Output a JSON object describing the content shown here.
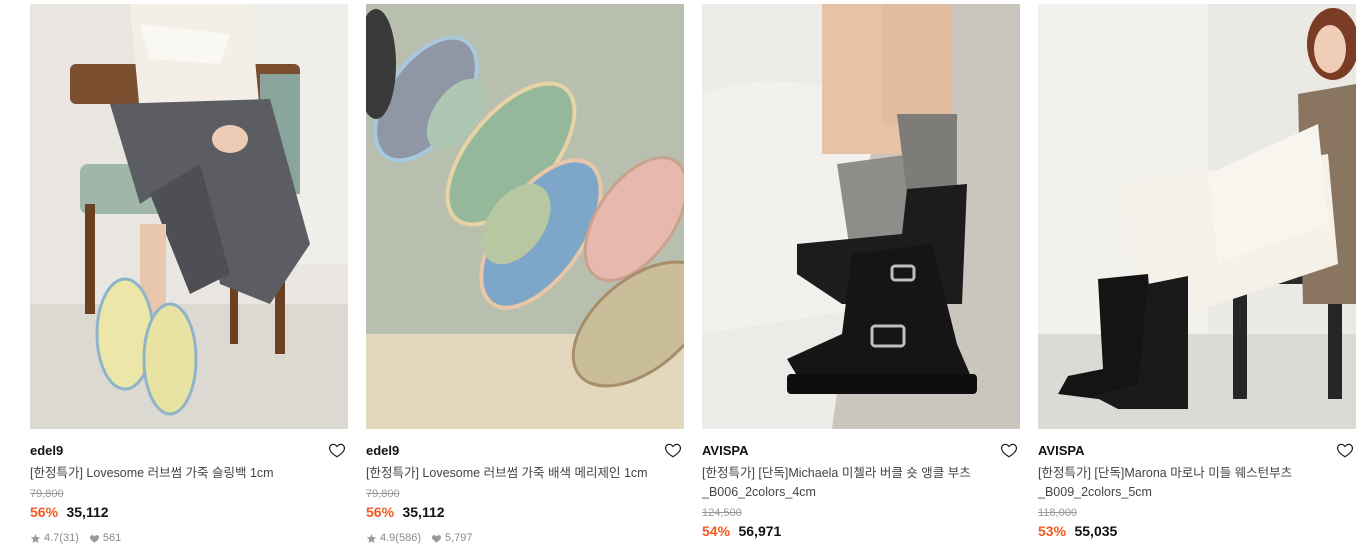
{
  "colors": {
    "discount": "#f15a22",
    "price": "#111111",
    "original_price": "#9a9a9a",
    "meta": "#8a8a8a"
  },
  "products": [
    {
      "brand": "edel9",
      "title": "[한정특가] Lovesome 러브썸 가죽 슬링백 1cm",
      "original_price": "79,800",
      "discount": "56%",
      "price": "35,112",
      "rating": "4.7",
      "review_count": "(31)",
      "likes": "561",
      "image_icon": "pastel-slingback-flats-photo"
    },
    {
      "brand": "edel9",
      "title": "[한정특가] Lovesome 러브썸 가죽 배색 메리제인 1cm",
      "original_price": "79,800",
      "discount": "56%",
      "price": "35,112",
      "rating": "4.9",
      "review_count": "(586)",
      "likes": "5,797",
      "image_icon": "colorful-mary-jane-flats-photo"
    },
    {
      "brand": "AVISPA",
      "title": "[한정특가] [단독]Michaela 미첼라 버클 숏 앵클 부츠_B006_2colors_4cm",
      "original_price": "124,500",
      "discount": "54%",
      "price": "56,971",
      "image_icon": "black-buckle-ankle-boots-photo"
    },
    {
      "brand": "AVISPA",
      "title": "[한정특가] [단독]Marona 마로나 미들 웨스턴부츠_B009_2colors_5cm",
      "original_price": "118,000",
      "discount": "53%",
      "price": "55,035",
      "image_icon": "black-western-boots-photo"
    }
  ]
}
